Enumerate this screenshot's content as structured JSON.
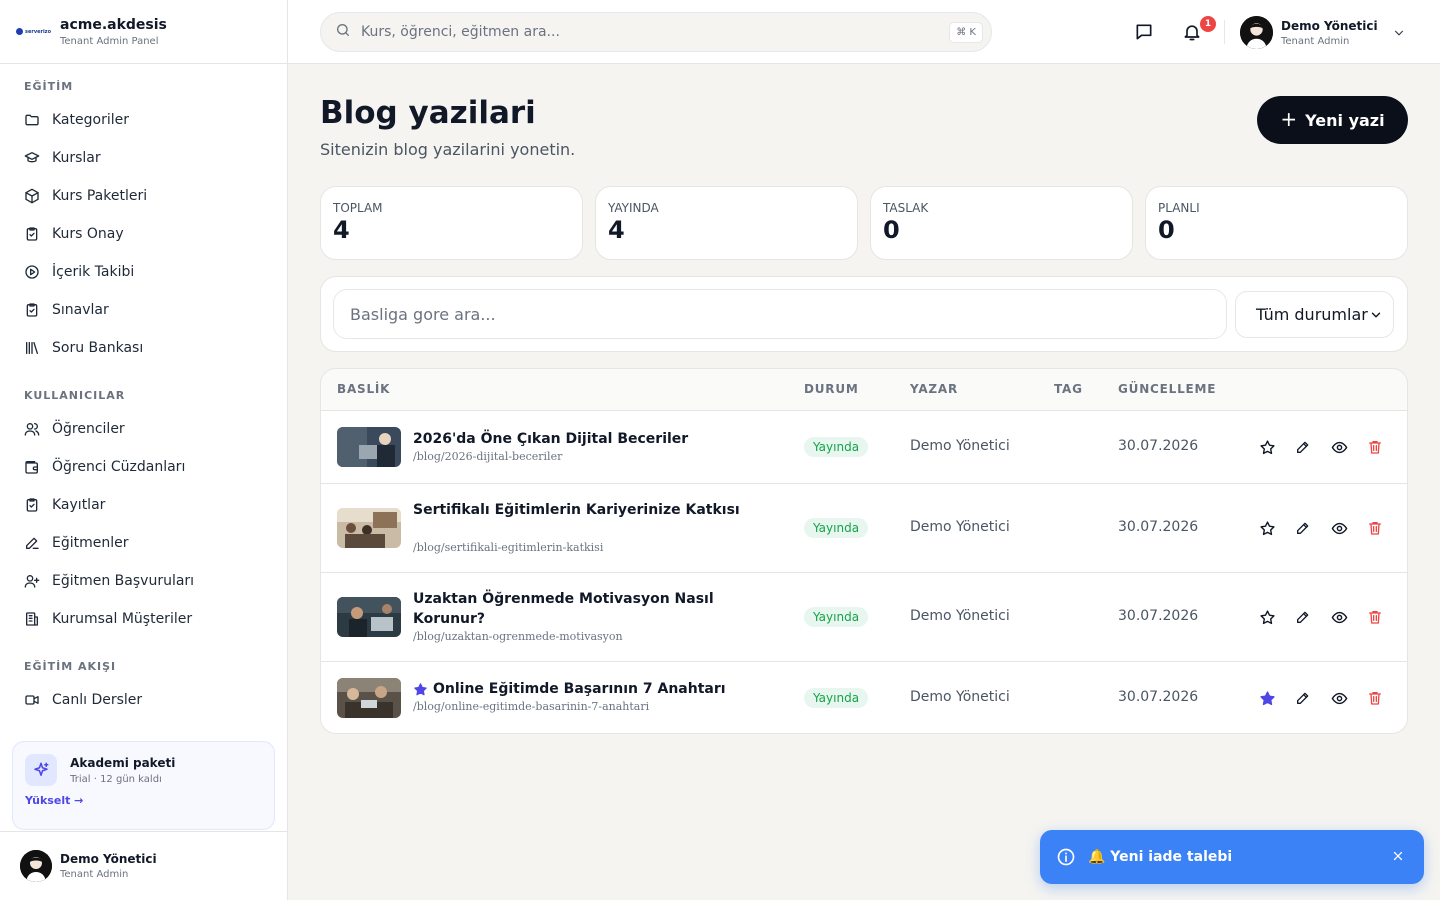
{
  "brand": {
    "logo_text": "serverizo",
    "title": "acme.akdesis",
    "subtitle": "Tenant Admin Panel"
  },
  "sidebar": {
    "sections": [
      {
        "title": "EĞİTİM",
        "items": [
          {
            "label": "Kategoriler",
            "icon": "folder-icon"
          },
          {
            "label": "Kurslar",
            "icon": "graduation-cap-icon"
          },
          {
            "label": "Kurs Paketleri",
            "icon": "package-icon"
          },
          {
            "label": "Kurs Onay",
            "icon": "clipboard-check-icon"
          },
          {
            "label": "İçerik Takibi",
            "icon": "play-circle-icon"
          },
          {
            "label": "Sınavlar",
            "icon": "clipboard-check-icon"
          },
          {
            "label": "Soru Bankası",
            "icon": "library-icon"
          }
        ]
      },
      {
        "title": "KULLANICILAR",
        "items": [
          {
            "label": "Öğrenciler",
            "icon": "users-icon"
          },
          {
            "label": "Öğrenci Cüzdanları",
            "icon": "wallet-icon"
          },
          {
            "label": "Kayıtlar",
            "icon": "clipboard-check-icon"
          },
          {
            "label": "Eğitmenler",
            "icon": "pencil-icon"
          },
          {
            "label": "Eğitmen Başvuruları",
            "icon": "user-plus-icon"
          },
          {
            "label": "Kurumsal Müşteriler",
            "icon": "building-icon"
          }
        ]
      },
      {
        "title": "EĞİTİM AKIŞI",
        "items": [
          {
            "label": "Canlı Dersler",
            "icon": "video-icon"
          }
        ]
      }
    ],
    "promo": {
      "title": "Akademi paketi",
      "subtitle": "Trial · 12 gün kaldı",
      "link": "Yükselt →"
    },
    "user": {
      "name": "Demo Yönetici",
      "role": "Tenant Admin"
    }
  },
  "topbar": {
    "search_placeholder": "Kurs, öğrenci, eğitmen ara...",
    "shortcut": "⌘ K",
    "notification_count": "1",
    "user": {
      "name": "Demo Yönetici",
      "role": "Tenant Admin"
    }
  },
  "page": {
    "title": "Blog yazilari",
    "subtitle": "Sitenizin blog yazilarini yonetin.",
    "new_button": "Yeni yazi"
  },
  "stats": [
    {
      "label": "TOPLAM",
      "value": "4"
    },
    {
      "label": "YAYINDA",
      "value": "4"
    },
    {
      "label": "TASLAK",
      "value": "0"
    },
    {
      "label": "PLANLI",
      "value": "0"
    }
  ],
  "filters": {
    "search_placeholder": "Basliga gore ara...",
    "status_value": "Tüm durumlar"
  },
  "table": {
    "columns": [
      "BASLİK",
      "DURUM",
      "YAZAR",
      "TAG",
      "GÜNCELLEME"
    ],
    "rows": [
      {
        "title": "2026'da Öne Çıkan Dijital Beceriler",
        "slug": "/blog/2026-dijital-beceriler",
        "status": "Yayında",
        "author": "Demo Yönetici",
        "tag": "",
        "updated": "30.07.2026",
        "featured": false
      },
      {
        "title": "Sertifikalı Eğitimlerin Kariyerinize Katkısı",
        "slug": "/blog/sertifikali-egitimlerin-katkisi",
        "status": "Yayında",
        "author": "Demo Yönetici",
        "tag": "",
        "updated": "30.07.2026",
        "featured": false
      },
      {
        "title": "Uzaktan Öğrenmede Motivasyon Nasıl Korunur?",
        "slug": "/blog/uzaktan-ogrenmede-motivasyon",
        "status": "Yayında",
        "author": "Demo Yönetici",
        "tag": "",
        "updated": "30.07.2026",
        "featured": false
      },
      {
        "title": "Online Eğitimde Başarının 7 Anahtarı",
        "slug": "/blog/online-egitimde-basarinin-7-anahtari",
        "status": "Yayında",
        "author": "Demo Yönetici",
        "tag": "",
        "updated": "30.07.2026",
        "featured": true
      }
    ]
  },
  "toast": {
    "text": "🔔 Yeni iade talebi"
  },
  "colors": {
    "accent": "#4f46e5",
    "toast": "#3b82f6",
    "published": "#16a34a",
    "danger": "#ef4444",
    "primary_button": "#0b0f1a"
  }
}
